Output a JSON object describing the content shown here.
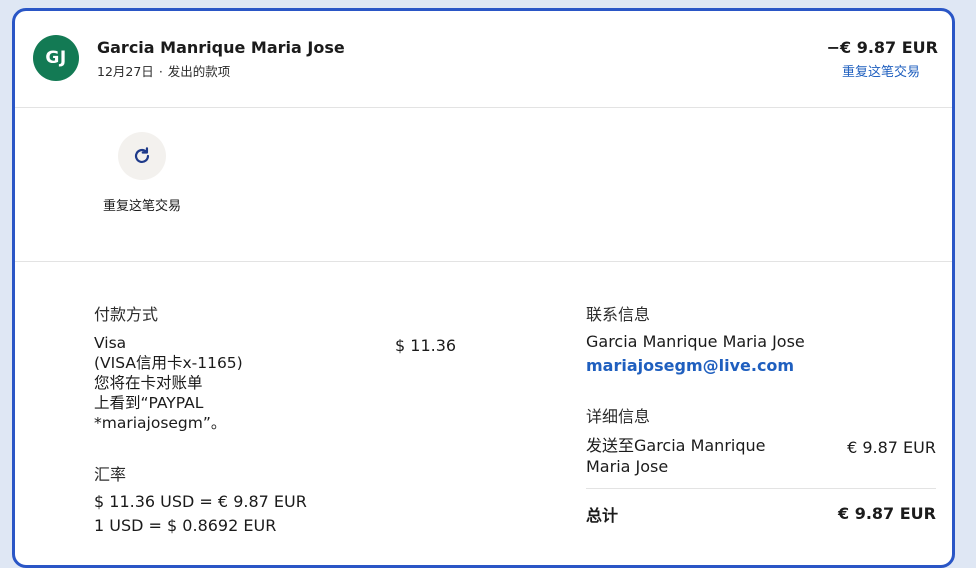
{
  "header": {
    "avatar_initials": "GJ",
    "merchant_name": "Garcia Manrique Maria Jose",
    "date": "12月27日",
    "separator": "·",
    "type": "发出的款项",
    "amount": "−€ 9.87 EUR",
    "repeat_link": "重复这笔交易"
  },
  "actions": {
    "repeat_icon": "refresh-icon",
    "repeat_label": "重复这笔交易"
  },
  "payment": {
    "title": "付款方式",
    "lines": [
      "Visa",
      "(VISA信用卡x-1165)",
      "您将在卡对账单",
      "上看到“PAYPAL",
      "*mariajosegm”。"
    ],
    "amount": "$ 11.36"
  },
  "exchange": {
    "title": "汇率",
    "line1": "$ 11.36 USD = € 9.87 EUR",
    "line2": "1 USD = $ 0.8692 EUR"
  },
  "contact": {
    "title": "联系信息",
    "name": "Garcia Manrique Maria Jose",
    "email": "mariajosegm@live.com"
  },
  "detail": {
    "title": "详细信息",
    "ship_label": "发送至Garcia Manrique Maria Jose",
    "ship_amount": "€ 9.87 EUR",
    "total_label": "总计",
    "total_amount": "€ 9.87 EUR"
  },
  "colors": {
    "accent_border": "#2a56c6",
    "avatar_bg": "#137a54",
    "link": "#1f5fbf"
  }
}
